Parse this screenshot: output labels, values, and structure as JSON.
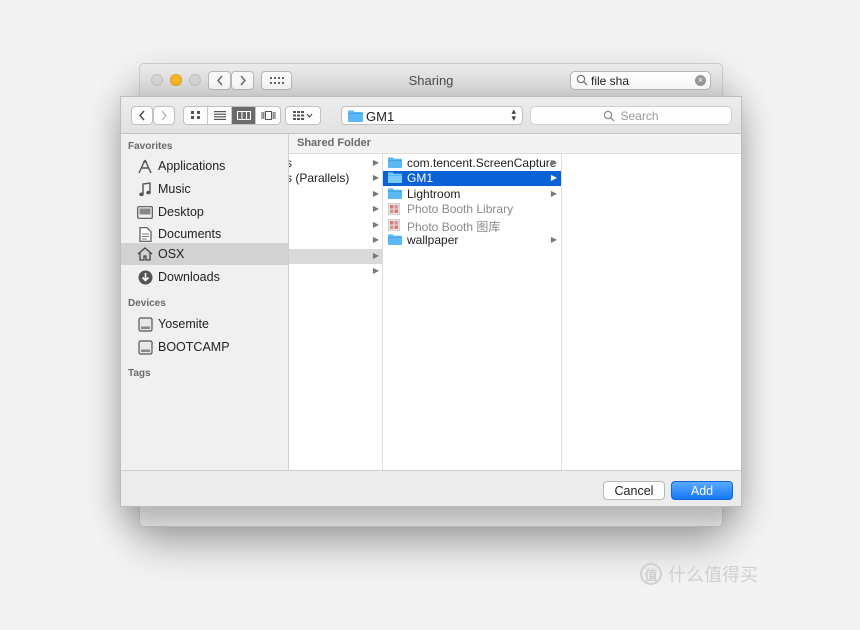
{
  "background_window": {
    "title": "Sharing",
    "search_value": "file sha"
  },
  "dialog": {
    "path_popup": "GM1",
    "search_placeholder": "Search",
    "column_header": "Shared Folder",
    "sidebar": {
      "favorites_label": "Favorites",
      "favorites": [
        {
          "label": "Applications",
          "icon": "applications-icon"
        },
        {
          "label": "Music",
          "icon": "music-icon"
        },
        {
          "label": "Desktop",
          "icon": "desktop-icon"
        },
        {
          "label": "Documents",
          "icon": "documents-icon"
        },
        {
          "label": "OSX",
          "icon": "home-icon",
          "selected": true
        },
        {
          "label": "Downloads",
          "icon": "downloads-icon"
        }
      ],
      "devices_label": "Devices",
      "devices": [
        {
          "label": "Yosemite",
          "icon": "disk-icon"
        },
        {
          "label": "BOOTCAMP",
          "icon": "disk-icon"
        }
      ],
      "tags_label": "Tags"
    },
    "column1": [
      {
        "label": "s",
        "has_children": true
      },
      {
        "label": "s (Parallels)",
        "has_children": true
      },
      {
        "label": "",
        "has_children": true
      },
      {
        "label": "",
        "has_children": true
      },
      {
        "label": "",
        "has_children": true
      },
      {
        "label": "",
        "has_children": true
      },
      {
        "label": "",
        "has_children": true,
        "highlighted": true
      },
      {
        "label": "",
        "has_children": true
      }
    ],
    "column2": [
      {
        "label": "com.tencent.ScreenCapture",
        "kind": "folder",
        "has_children": true
      },
      {
        "label": "GM1",
        "kind": "folder",
        "has_children": true,
        "selected": true
      },
      {
        "label": "Lightroom",
        "kind": "folder",
        "has_children": true
      },
      {
        "label": "Photo Booth Library",
        "kind": "library",
        "has_children": false,
        "dim": true
      },
      {
        "label": "Photo Booth 图库",
        "kind": "library",
        "has_children": false,
        "dim": true
      },
      {
        "label": "wallpaper",
        "kind": "folder",
        "has_children": true
      }
    ],
    "buttons": {
      "cancel": "Cancel",
      "add": "Add"
    }
  },
  "watermark": "什么值得买",
  "colors": {
    "selection_blue": "#0b61d6",
    "add_button": "#1478f6",
    "folder_blue": "#5bb8f5",
    "minimize_yellow": "#f5b92b"
  }
}
